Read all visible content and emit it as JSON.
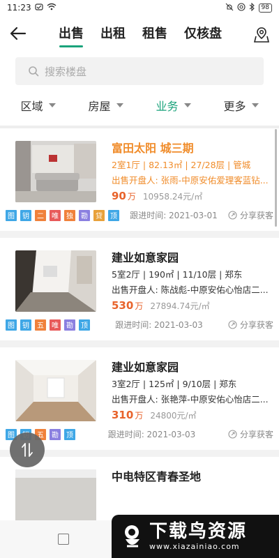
{
  "status_bar": {
    "time": "11:23",
    "battery": "98"
  },
  "header": {
    "tabs": [
      "出售",
      "出租",
      "租售",
      "仅核盘"
    ]
  },
  "search": {
    "placeholder": "搜索楼盘"
  },
  "filters": [
    "区域",
    "房屋",
    "业务",
    "更多"
  ],
  "listings": [
    {
      "title": "富田太阳 城三期",
      "meta": "2室1厅 | 82.13㎡ | 27/28层 | 管城",
      "owner": "出售开盘人: 张雨-中原安佑爱理客蓝钻...",
      "price": "90",
      "price_unit": "万",
      "unit_price": "10958.24元/㎡",
      "tags": [
        "图",
        "钥",
        "二",
        "唯",
        "独",
        "勘",
        "贷",
        "顶"
      ],
      "followup": "跟进时间: 2021-03-01",
      "share": "分享获客"
    },
    {
      "title": "建业如意家园",
      "meta": "5室2厅 | 190㎡ | 11/10层 | 郑东",
      "owner": "出售开盘人: 陈战彪-中原安佑心怡店二...",
      "price": "530",
      "price_unit": "万",
      "unit_price": "27894.74元/㎡",
      "tags": [
        "图",
        "钥",
        "五",
        "唯",
        "勘",
        "顶"
      ],
      "followup": "跟进时间: 2021-03-03",
      "share": "分享获客"
    },
    {
      "title": "建业如意家园",
      "meta": "3室2厅 | 125㎡ | 9/10层 | 郑东",
      "owner": "出售开盘人: 张艳萍-中原安佑心怡店二...",
      "price": "310",
      "price_unit": "万",
      "unit_price": "24800元/㎡",
      "tags": [
        "图",
        "钥",
        "五",
        "勘",
        "顶"
      ],
      "followup": "跟进时间: 2021-03-03",
      "share": "分享获客"
    },
    {
      "title": "中电特区青春圣地"
    }
  ],
  "tag_colors": {
    "图": "#3fa7e6",
    "钥": "#3fa7e6",
    "二": "#f0813b",
    "五": "#f0813b",
    "唯": "#e85a5a",
    "独": "#f0813b",
    "勘": "#8a7fe0",
    "贷": "#e8a13a",
    "顶": "#3fa7e6"
  },
  "watermark": {
    "main": "下载鸟资源",
    "url": "www.xiazainiao.com"
  },
  "accent_color": "#1aa37b"
}
